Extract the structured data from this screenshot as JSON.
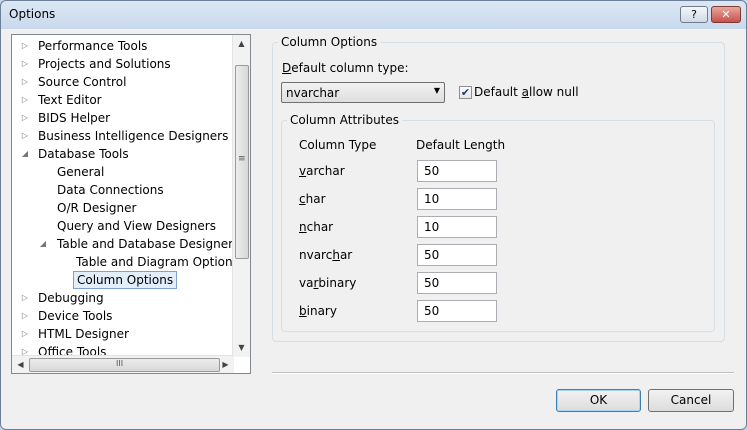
{
  "window": {
    "title": "Options",
    "help_label": "?",
    "close_label": "✕"
  },
  "tree": {
    "items": [
      {
        "label": "Performance Tools",
        "expander": "▷"
      },
      {
        "label": "Projects and Solutions",
        "expander": "▷"
      },
      {
        "label": "Source Control",
        "expander": "▷"
      },
      {
        "label": "Text Editor",
        "expander": "▷"
      },
      {
        "label": "BIDS Helper",
        "expander": "▷"
      },
      {
        "label": "Business Intelligence Designers",
        "expander": "▷"
      },
      {
        "label": "Database Tools",
        "expander": "◢"
      },
      {
        "label": "General",
        "expander": ""
      },
      {
        "label": "Data Connections",
        "expander": ""
      },
      {
        "label": "O/R Designer",
        "expander": ""
      },
      {
        "label": "Query and View Designers",
        "expander": ""
      },
      {
        "label": "Table and Database Designers",
        "expander": "◢"
      },
      {
        "label": "Table and Diagram Options",
        "expander": ""
      },
      {
        "label": "Column Options",
        "expander": "",
        "selected": true
      },
      {
        "label": "Debugging",
        "expander": "▷"
      },
      {
        "label": "Device Tools",
        "expander": "▷"
      },
      {
        "label": "HTML Designer",
        "expander": "▷"
      },
      {
        "label": "Office Tools",
        "expander": "▷"
      }
    ],
    "scroll_up": "▲",
    "scroll_down": "▼",
    "scroll_left": "◀",
    "scroll_right": "▶",
    "v_grip": "≡",
    "h_grip": "III"
  },
  "column_options": {
    "group_title": "Column Options",
    "default_type_label_u": "D",
    "default_type_label_rest": "efault column type:",
    "default_type_value": "nvarchar",
    "combo_arrow": "▼",
    "allow_null_checked": "✔",
    "allow_null_pre": "Default ",
    "allow_null_u": "a",
    "allow_null_post": "llow null"
  },
  "attributes": {
    "group_title": "Column Attributes",
    "col_type_header": "Column Type",
    "default_length_header": "Default Length",
    "rows": [
      {
        "pre": "",
        "u": "v",
        "post": "archar",
        "value": "50"
      },
      {
        "pre": "",
        "u": "c",
        "post": "har",
        "value": "10"
      },
      {
        "pre": "",
        "u": "n",
        "post": "char",
        "value": "10"
      },
      {
        "pre": "nvarc",
        "u": "h",
        "post": "ar",
        "value": "50"
      },
      {
        "pre": "va",
        "u": "r",
        "post": "binary",
        "value": "50"
      },
      {
        "pre": "",
        "u": "b",
        "post": "inary",
        "value": "50"
      }
    ]
  },
  "buttons": {
    "ok": "OK",
    "cancel": "Cancel"
  }
}
